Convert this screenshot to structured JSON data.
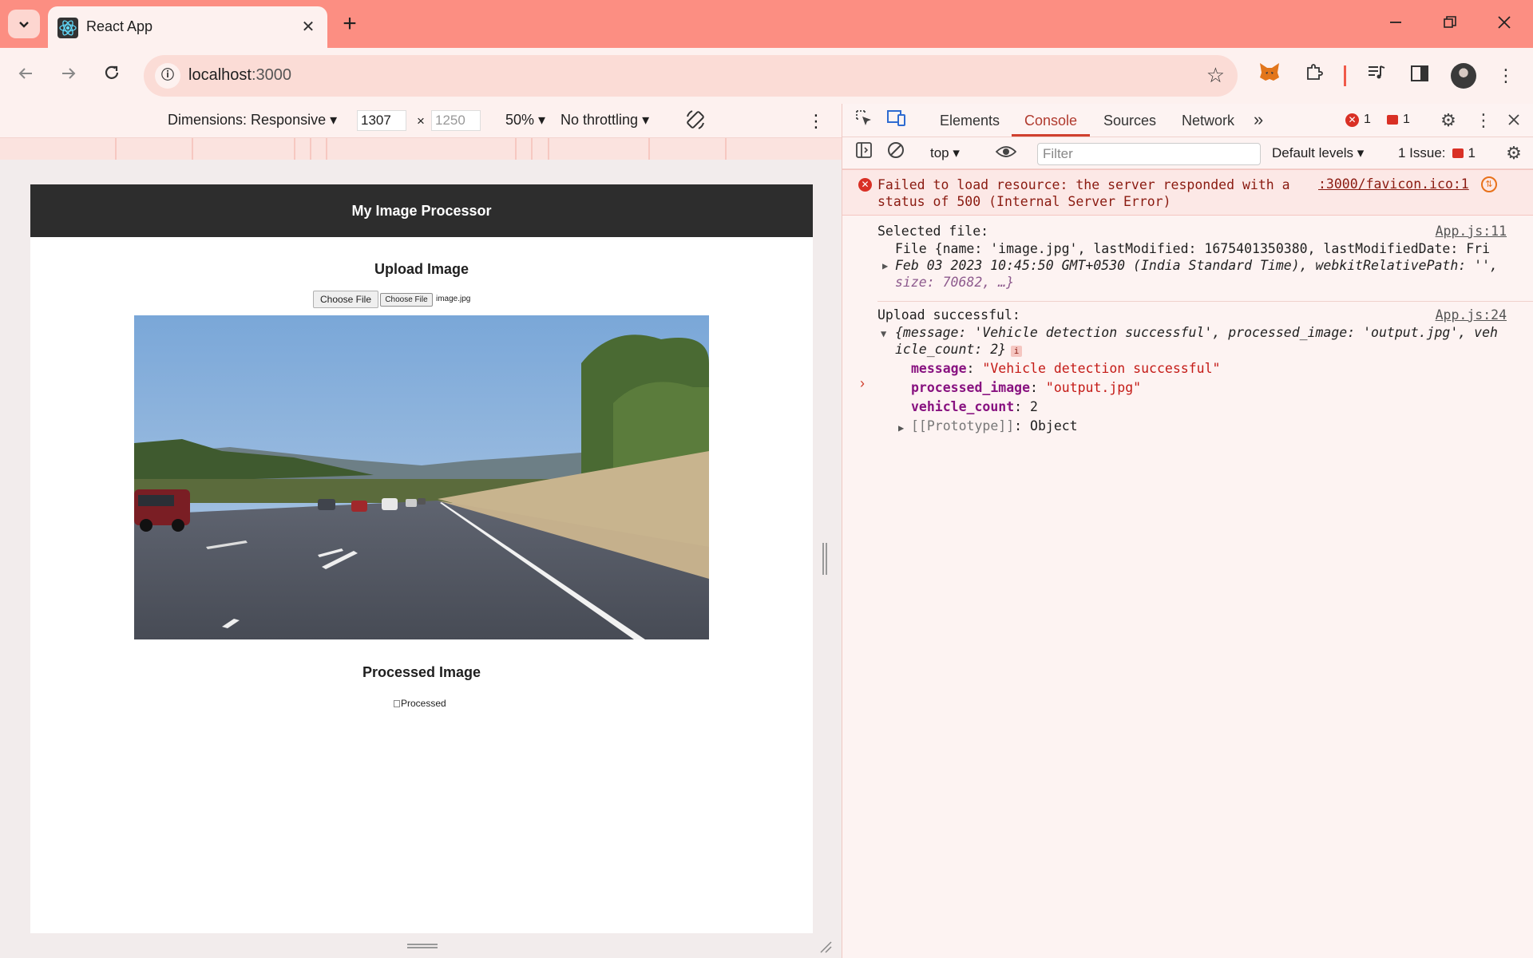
{
  "browser": {
    "tab_title": "React App",
    "url_host": "localhost",
    "url_port": ":3000",
    "close_glyph": "✕",
    "new_tab_glyph": "+",
    "colors": {
      "titlebar": "#fc8e82",
      "toolbar": "#fdf1ef",
      "accent": "#d0402f"
    }
  },
  "device_toolbar": {
    "dimensions_label": "Dimensions: Responsive",
    "width_value": "1307",
    "height_placeholder": "1250",
    "times": "×",
    "zoom": "50%",
    "throttling": "No throttling"
  },
  "page": {
    "header_title": "My Image Processor",
    "upload_heading": "Upload Image",
    "choose_file_outer": "Choose File",
    "choose_file_inner": "Choose File",
    "file_name": "image.jpg",
    "processed_heading": "Processed Image",
    "processed_alt": "Processed"
  },
  "devtools": {
    "tabs": [
      "Elements",
      "Console",
      "Sources",
      "Network"
    ],
    "more_tabs": "»",
    "error_count": "1",
    "message_count": "1",
    "context": "top",
    "filter_placeholder": "Filter",
    "levels": "Default levels",
    "issues_label": "1 Issue:",
    "issues_count": "1",
    "console": {
      "error_text": "Failed to load resource: the server responded with a status of 500 (Internal Server Error)",
      "error_source": ":3000/favicon.ico:1",
      "log1_label": "Selected file:",
      "log1_source": "App.js:11",
      "log1_line1": "File {name: 'image.jpg', lastModified: 1675401350380, lastModifiedDate: Fri",
      "log1_line2": "Feb 03 2023 10:45:50 GMT+0530 (India Standard Time), webkitRelativePath: '',",
      "log1_line3": "size: 70682, …}",
      "log2_label": "Upload successful:",
      "log2_source": "App.js:24",
      "log2_line1": "{message: 'Vehicle detection successful', processed_image: 'output.jpg', veh",
      "log2_line2": "icle_count: 2}",
      "prop_message_key": "message",
      "prop_message_val": "\"Vehicle detection successful\"",
      "prop_image_key": "processed_image",
      "prop_image_val": "\"output.jpg\"",
      "prop_count_key": "vehicle_count",
      "prop_count_val": "2",
      "prop_proto_key": "[[Prototype]]",
      "prop_proto_val": "Object"
    }
  }
}
